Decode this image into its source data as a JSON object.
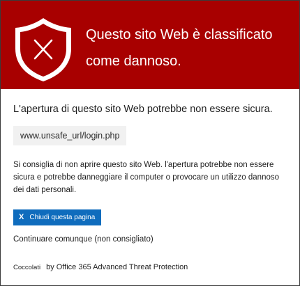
{
  "header": {
    "title_line1": "Questo sito Web è classificato",
    "title_line2": "come dannoso.",
    "background_color": "#a80000",
    "shield_icon": "shield-x-icon"
  },
  "main": {
    "headline": "L'apertura di questo sito Web potrebbe non essere sicura.",
    "url": "www.unsafe_url/login.php",
    "description": "Si consiglia di non aprire questo sito Web. l'apertura potrebbe non essere sicura e potrebbe danneggiare il computer o provocare un utilizzo dannoso dei dati personali."
  },
  "actions": {
    "close_button_label": "Chiudi questa pagina",
    "close_icon": "X",
    "continue_link": "Continuare comunque (non consigliato)"
  },
  "footer": {
    "prefix": "Coccolati",
    "provider": "by Office 365 Advanced Threat Protection"
  },
  "colors": {
    "accent": "#a80000",
    "button": "#0f6cbd"
  }
}
